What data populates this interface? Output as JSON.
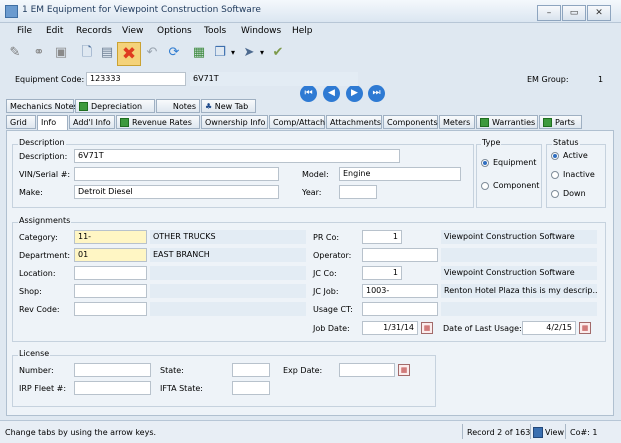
{
  "window": {
    "title": "1 EM Equipment for Viewpoint Construction Software"
  },
  "menu": [
    "File",
    "Edit",
    "Records",
    "View",
    "Options",
    "Tools",
    "Windows",
    "Help"
  ],
  "header": {
    "equipment_code_label": "Equipment Code:",
    "equipment_code": "123333",
    "equipment_desc": "6V71T",
    "em_group_label": "EM Group:",
    "em_group": "1"
  },
  "tabs_row1": [
    "Mechanics Notes",
    "Depreciation",
    "Notes",
    "New Tab"
  ],
  "tabs_row2": [
    "Grid",
    "Info",
    "Add'l Info",
    "Revenue Rates",
    "Ownership Info",
    "Comp/Attach",
    "Attachments",
    "Components",
    "Meters",
    "Warranties",
    "Parts"
  ],
  "description": {
    "group": "Description",
    "description_label": "Description:",
    "description": "6V71T",
    "vin_label": "VIN/Serial #:",
    "vin": "",
    "model_label": "Model:",
    "model": "Engine",
    "make_label": "Make:",
    "make": "Detroit Diesel",
    "year_label": "Year:",
    "year": ""
  },
  "type": {
    "group": "Type",
    "options": [
      "Equipment",
      "Component"
    ],
    "selected": "Equipment"
  },
  "status": {
    "group": "Status",
    "options": [
      "Active",
      "Inactive",
      "Down"
    ],
    "selected": "Active"
  },
  "assignments": {
    "group": "Assignments",
    "category_label": "Category:",
    "category": "11-",
    "category_desc": "OTHER TRUCKS",
    "department_label": "Department:",
    "department": "01",
    "department_desc": "EAST BRANCH",
    "location_label": "Location:",
    "location": "",
    "shop_label": "Shop:",
    "shop": "",
    "rev_code_label": "Rev Code:",
    "rev_code": "",
    "pr_co_label": "PR Co:",
    "pr_co": "1",
    "pr_co_desc": "Viewpoint Construction Software",
    "operator_label": "Operator:",
    "operator": "",
    "jc_co_label": "JC Co:",
    "jc_co": "1",
    "jc_co_desc": "Viewpoint Construction Software",
    "jc_job_label": "JC Job:",
    "jc_job": "1003-",
    "jc_job_desc": "Renton Hotel Plaza this is my descrip...",
    "usage_ct_label": "Usage CT:",
    "usage_ct": "",
    "job_date_label": "Job Date:",
    "job_date": "1/31/14",
    "last_usage_label": "Date of Last Usage:",
    "last_usage": "4/2/15"
  },
  "license": {
    "group": "License",
    "number_label": "Number:",
    "number": "",
    "state_label": "State:",
    "state": "",
    "exp_date_label": "Exp Date:",
    "exp_date": "",
    "irp_label": "IRP Fleet #:",
    "irp": "",
    "ifta_label": "IFTA State:",
    "ifta": ""
  },
  "statusbar": {
    "hint": "Change tabs by using the arrow keys.",
    "record": "Record 2 of 163",
    "view": "View",
    "co": "Co#: 1"
  }
}
